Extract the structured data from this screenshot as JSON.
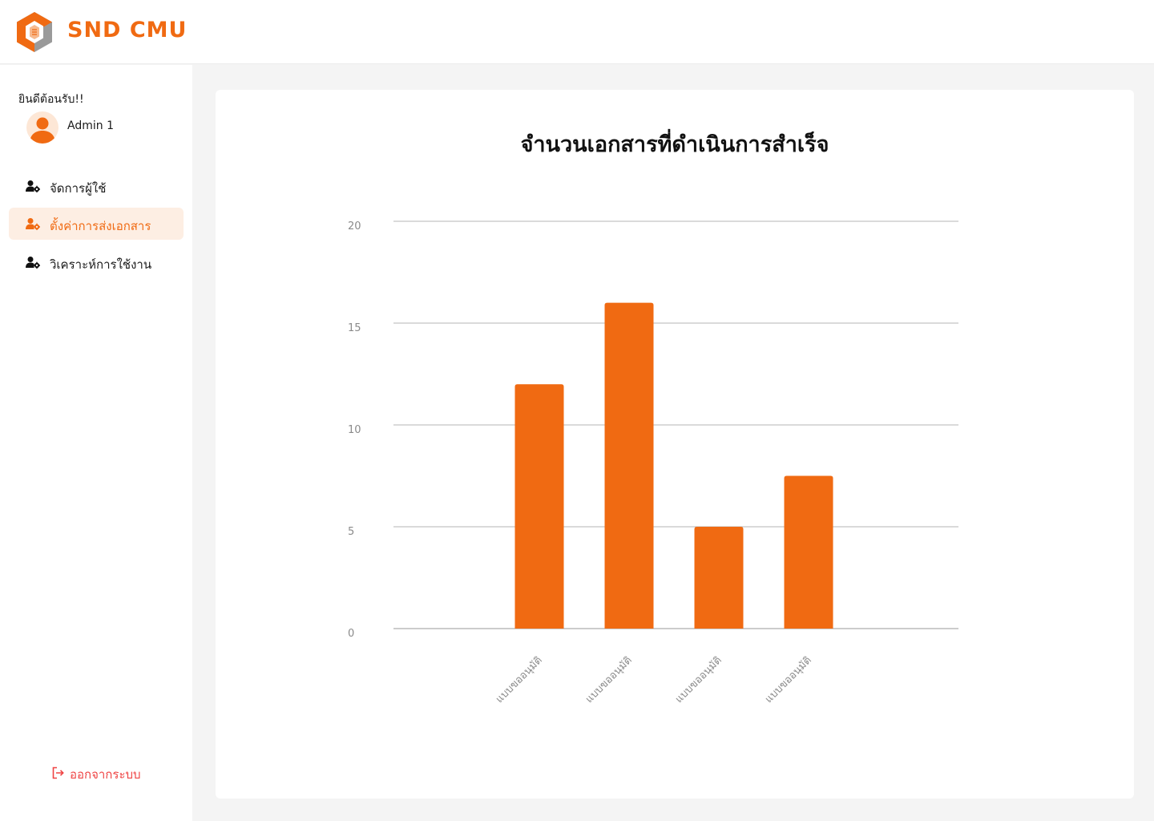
{
  "app": {
    "brand": "SND CMU",
    "colors": {
      "accent": "#f06a12",
      "accent_light": "#fdeee3",
      "danger": "#ef4444",
      "background": "#f4f4f4"
    }
  },
  "sidebar": {
    "welcome": "ยินดีต้อนรับ!!",
    "user_name": "Admin 1",
    "items": [
      {
        "label": "จัดการผู้ใช้",
        "icon": "user-gear-icon",
        "active": false
      },
      {
        "label": "ตั้งค่าการส่งเอกสาร",
        "icon": "user-gear-icon",
        "active": true
      },
      {
        "label": "วิเคราะห์การใช้งาน",
        "icon": "user-gear-icon",
        "active": false
      }
    ],
    "logout_label": "ออกจากระบบ",
    "logout_icon": "logout-icon"
  },
  "main": {
    "title": "จำนวนเอกสารที่ดำเนินการสำเร็จ"
  },
  "chart_data": {
    "type": "bar",
    "title": "จำนวนเอกสารที่ดำเนินการสำเร็จ",
    "categories": [
      "แบบขออนุมัติ",
      "แบบขออนุมัติ",
      "แบบขออนุมัติ",
      "แบบขออนุมัติ"
    ],
    "values": [
      12,
      16,
      5,
      7.5
    ],
    "ylim": [
      0,
      20
    ],
    "yticks": [
      0,
      5,
      10,
      15,
      20
    ],
    "xlabel": "",
    "ylabel": "",
    "grid": true,
    "bar_color": "#f06a12"
  }
}
